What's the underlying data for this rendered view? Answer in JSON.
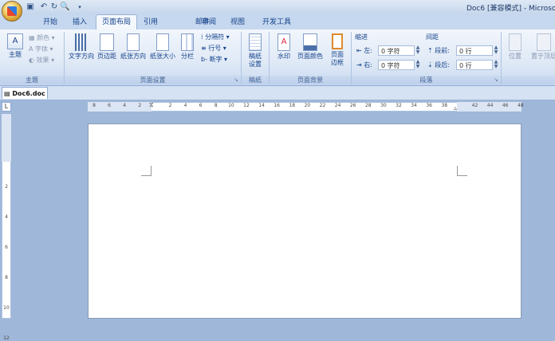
{
  "window": {
    "title": "Doc6 [兼容模式] - Microso"
  },
  "quick_access": [
    "save-icon",
    "undo-icon",
    "redo-icon",
    "print-preview-icon",
    "customize-icon"
  ],
  "tabs": [
    {
      "label": "开始"
    },
    {
      "label": "插入"
    },
    {
      "label": "页面布局",
      "active": true
    },
    {
      "label": "引用"
    },
    {
      "label": "邮件"
    },
    {
      "label": "审阅"
    },
    {
      "label": "视图"
    },
    {
      "label": "开发工具"
    }
  ],
  "ribbon": {
    "theme": {
      "main_label": "主题",
      "colors": "颜色",
      "fonts": "字体",
      "effects": "效果",
      "group": "主题"
    },
    "page_setup": {
      "text_direction": "文字方向",
      "margins": "页边距",
      "orientation": "纸张方向",
      "size": "纸张大小",
      "columns": "分栏",
      "breaks": "分隔符",
      "line_numbers": "行号",
      "hyphenation": "断字",
      "group": "页面设置"
    },
    "draft": {
      "label1": "稿纸",
      "label2": "设置",
      "group": "稿纸"
    },
    "page_background": {
      "watermark": "水印",
      "page_color": "页面颜色",
      "page_border1": "页面",
      "page_border2": "边框",
      "group": "页面背景"
    },
    "paragraph": {
      "indent_title": "缩进",
      "left_label": "左:",
      "left_value": "0 字符",
      "right_label": "右:",
      "right_value": "0 字符",
      "spacing_title": "间距",
      "before_label": "段前:",
      "before_value": "0 行",
      "after_label": "段后:",
      "after_value": "0 行",
      "group": "段落"
    },
    "arrange": {
      "position": "位置",
      "bring_front": "置于顶层"
    }
  },
  "document": {
    "tab": "Doc6.doc"
  },
  "ruler": {
    "h_ticks": [
      "8",
      "6",
      "4",
      "2",
      "",
      "2",
      "4",
      "6",
      "8",
      "10",
      "12",
      "14",
      "16",
      "18",
      "20",
      "22",
      "24",
      "26",
      "28",
      "30",
      "32",
      "34",
      "36",
      "38",
      "",
      "42",
      "44",
      "46",
      "48"
    ],
    "v_ticks": [
      "2",
      "4",
      "6",
      "8",
      "10",
      "12"
    ]
  },
  "colors": {
    "accent": "#15428b",
    "ribbon": "#dfe9f6",
    "workspace": "#9fb7d8"
  }
}
